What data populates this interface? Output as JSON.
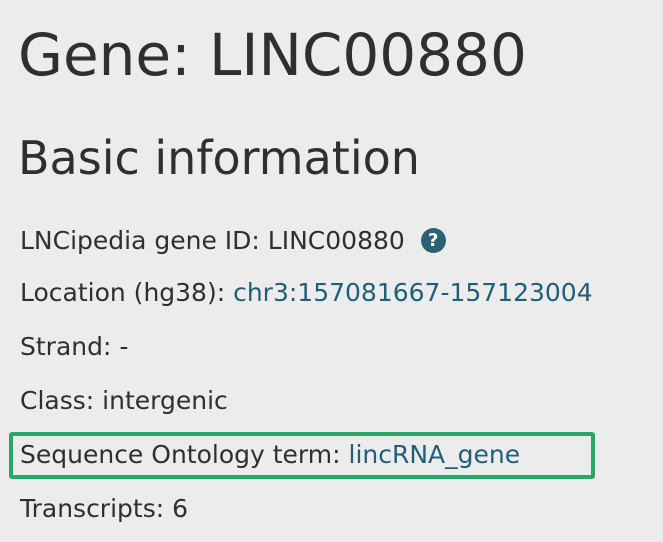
{
  "page": {
    "title": "Gene: LINC00880",
    "section_title": "Basic information"
  },
  "basic_info": {
    "gene_id": {
      "label": "LNCipedia gene ID:",
      "value": "LINC00880",
      "help_icon": "question-circle-icon"
    },
    "location": {
      "label": "Location (hg38):",
      "value": "chr3:157081667-157123004"
    },
    "strand": {
      "label": "Strand:",
      "value": "-"
    },
    "class": {
      "label": "Class:",
      "value": "intergenic"
    },
    "sequence_ontology": {
      "label": "Sequence Ontology term:",
      "value": "lincRNA_gene"
    },
    "transcripts": {
      "label": "Transcripts:",
      "value": "6"
    }
  },
  "colors": {
    "background": "#ececec",
    "text": "#2f2f2f",
    "link": "#1f5f78",
    "icon": "#2b6075",
    "highlight": "#2aa56b"
  }
}
